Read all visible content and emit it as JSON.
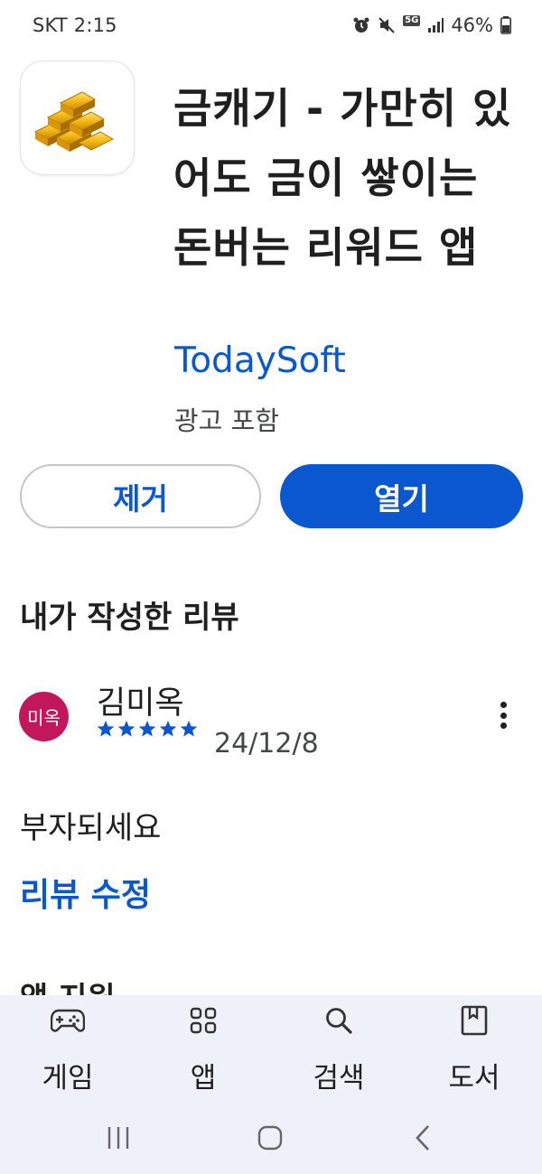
{
  "status_bar": {
    "carrier_time": "SKT 2:15",
    "network": "5G",
    "battery": "46%"
  },
  "app": {
    "title": "금캐기 - 가만히 있어도 금이 쌓이는 돈버는 리워드 앱",
    "developer": "TodaySoft",
    "ads_label": "광고 포함",
    "icon": "gold-bars-icon"
  },
  "actions": {
    "remove_label": "제거",
    "open_label": "열기"
  },
  "review_section": {
    "title": "내가 작성한 리뷰",
    "reviewer": {
      "avatar_text": "미옥",
      "name": "김미옥"
    },
    "rating": 5,
    "date": "24/12/8",
    "text": "부자되세요",
    "edit_label": "리뷰 수정"
  },
  "next_section": {
    "title_partial": "앱 지원"
  },
  "bottom_nav": {
    "items": [
      {
        "label": "게임",
        "icon": "gamepad-icon"
      },
      {
        "label": "앱",
        "icon": "apps-grid-icon"
      },
      {
        "label": "검색",
        "icon": "search-icon"
      },
      {
        "label": "도서",
        "icon": "book-icon"
      }
    ]
  },
  "colors": {
    "accent": "#0b57d0",
    "avatar": "#c2185b",
    "nav_bg": "#eef1f8"
  }
}
